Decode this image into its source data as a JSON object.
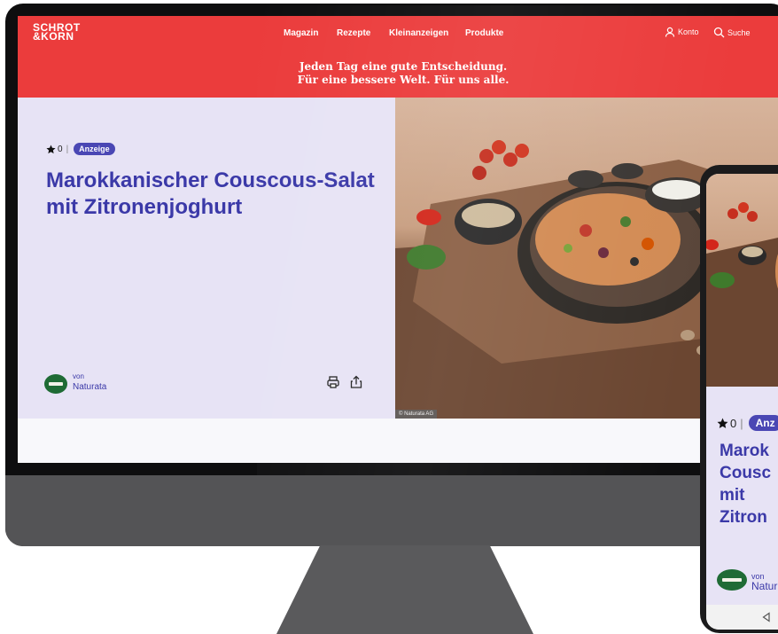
{
  "site": {
    "logo_line1": "SCHROT",
    "logo_line2": "&KORN",
    "nav": [
      "Magazin",
      "Rezepte",
      "Kleinanzeigen",
      "Produkte"
    ],
    "account_label": "Konto",
    "search_label": "Suche",
    "tagline_line1": "Jeden Tag eine gute Entscheidung.",
    "tagline_line2": "Für eine bessere Welt. Für uns alle."
  },
  "recipe": {
    "rating": "0",
    "badge": "Anzeige",
    "title": "Marokkanischer Couscous-Salat mit Zitronenjoghurt",
    "by_label": "von",
    "brand": "Naturata",
    "image_credit": "© Naturata AG"
  },
  "phone": {
    "rating": "0",
    "badge": "Anz",
    "title_lines": [
      "Marok",
      "Cousc",
      "mit",
      "Zitron"
    ],
    "by_label": "von",
    "brand": "Natur"
  },
  "colors": {
    "header_red": "#eb3c3c",
    "accent_purple": "#3b39a8",
    "badge_purple": "#4a47b4",
    "hero_lavender": "#e7e3f5"
  },
  "icons": [
    "user-icon",
    "search-icon",
    "star-icon",
    "print-icon",
    "share-icon",
    "back-nav-icon"
  ]
}
